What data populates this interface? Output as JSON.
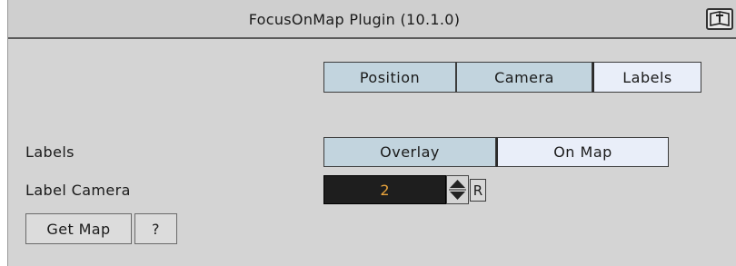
{
  "window": {
    "title": "FocusOnMap Plugin (10.1.0)",
    "help_icon": "help-book-icon"
  },
  "tabs": [
    {
      "label": "Position",
      "active": false
    },
    {
      "label": "Camera",
      "active": false
    },
    {
      "label": "Labels",
      "active": true
    }
  ],
  "labels_row": {
    "label": "Labels",
    "options": [
      {
        "label": "Overlay",
        "selected": false
      },
      {
        "label": "On Map",
        "selected": true
      }
    ]
  },
  "label_camera_row": {
    "label": "Label Camera",
    "value": "2",
    "reset_label": "R"
  },
  "buttons": {
    "get_map": "Get Map",
    "help": "?"
  },
  "colors": {
    "panel_bg": "#d4d4d4",
    "inactive_button": "#c2d4de",
    "active_button": "#e9eef9",
    "number_text": "#e8a33c",
    "number_bg": "#1e1e1e"
  }
}
